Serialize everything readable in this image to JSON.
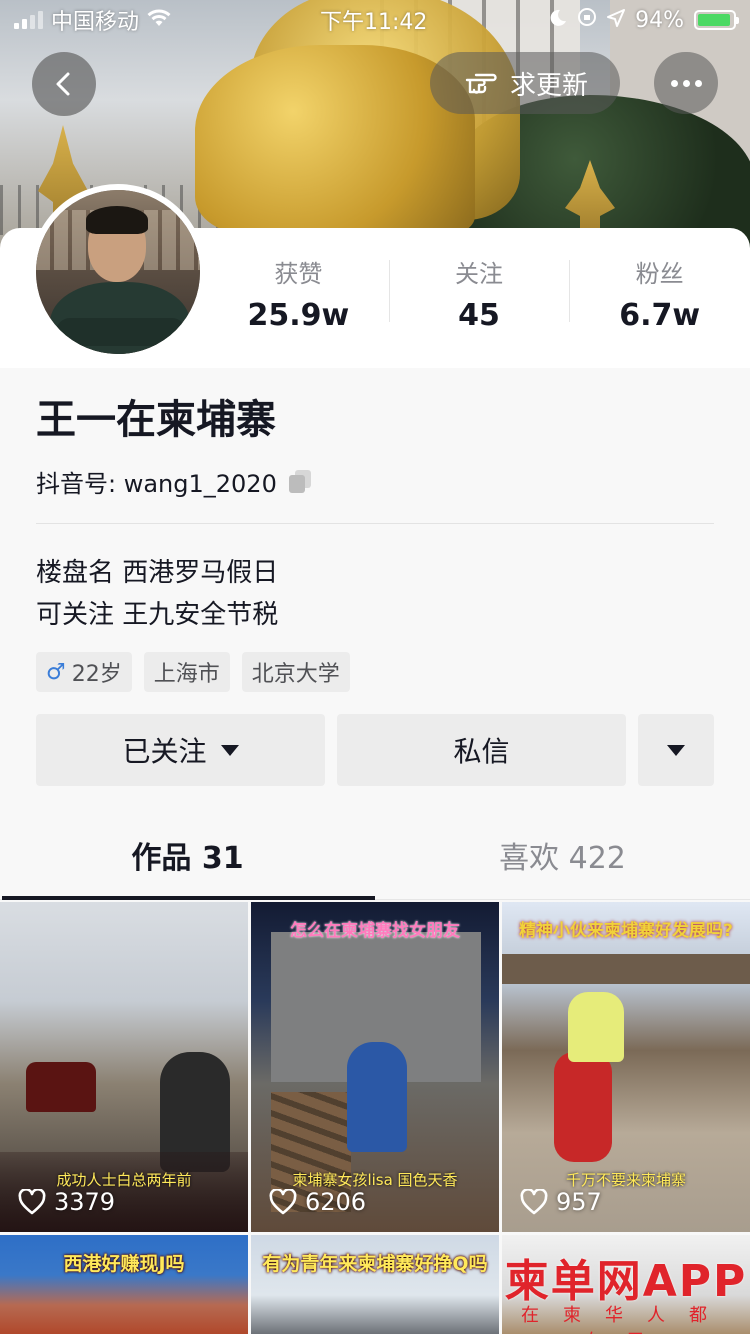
{
  "status_bar": {
    "carrier": "中国移动",
    "time": "下午11:42",
    "battery": "94%",
    "battery_level": 0.94
  },
  "header": {
    "update_label": "求更新"
  },
  "stats": [
    {
      "label": "获赞",
      "value": "25.9w"
    },
    {
      "label": "关注",
      "value": "45"
    },
    {
      "label": "粉丝",
      "value": "6.7w"
    }
  ],
  "profile": {
    "name": "王一在柬埔寨",
    "douyin_id": "抖音号: wang1_2020",
    "bio_lines": [
      "楼盘名 西港罗马假日",
      "可关注 王九安全节税"
    ],
    "tags": {
      "age": "22岁",
      "city": "上海市",
      "school": "北京大学"
    }
  },
  "actions": {
    "follow_label": "已关注",
    "message_label": "私信"
  },
  "tabs": [
    {
      "label": "作品 31"
    },
    {
      "label": "喜欢 422"
    }
  ],
  "videos": [
    {
      "overlay_top": "",
      "caption": "成功人士白总两年前",
      "likes": "3379"
    },
    {
      "overlay_top": "怎么在柬埔寨找女朋友",
      "caption": "柬埔寨女孩lisa 国色天香",
      "likes": "6206"
    },
    {
      "overlay_top": "精神小伙来柬埔寨好发展吗?",
      "caption": "千万不要来柬埔寨",
      "likes": "957"
    },
    {
      "overlay_top": "西港好赚现J吗",
      "caption": "",
      "likes": ""
    },
    {
      "overlay_top": "有为青年来柬埔寨好挣Q吗",
      "caption": "",
      "likes": ""
    },
    {
      "overlay_top": "",
      "watermark": "柬单网APP",
      "watermark_sub": "在柬华人都在用",
      "caption": "",
      "likes": ""
    }
  ],
  "colors": {
    "text_primary": "#161823",
    "text_secondary": "#8a8b91",
    "button_bg": "#ececec",
    "male_icon": "#3a7dd8"
  }
}
